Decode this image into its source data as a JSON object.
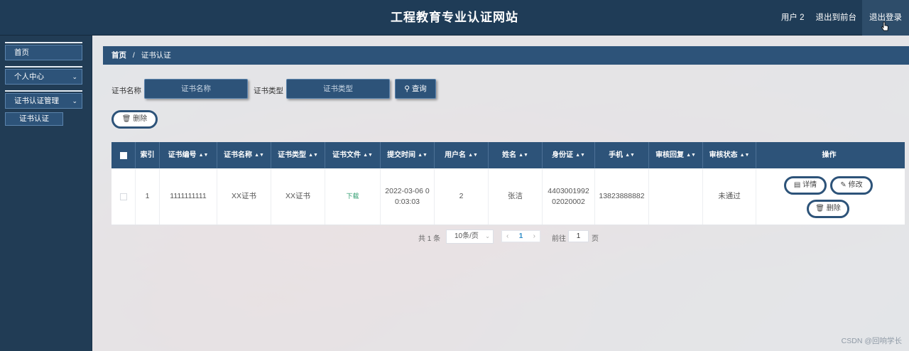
{
  "header": {
    "title": "工程教育专业认证网站",
    "user_label": "用户 2",
    "back_frontend": "退出到前台",
    "logout": "退出登录"
  },
  "sidebar": {
    "items": [
      {
        "label": "首页"
      },
      {
        "label": "个人中心"
      },
      {
        "label": "证书认证管理"
      }
    ],
    "sub_items": [
      {
        "label": "证书认证"
      }
    ]
  },
  "breadcrumb": {
    "home": "首页",
    "separator": "/",
    "current": "证书认证"
  },
  "search": {
    "name_label": "证书名称",
    "name_placeholder": "证书名称",
    "type_label": "证书类型",
    "type_placeholder": "证书类型",
    "query_button": "查询"
  },
  "toolbar": {
    "delete_label": "删除"
  },
  "table": {
    "columns": [
      "索引",
      "证书编号",
      "证书名称",
      "证书类型",
      "证书文件",
      "提交时间",
      "用户名",
      "姓名",
      "身份证",
      "手机",
      "审核回复",
      "审核状态",
      "操作"
    ],
    "rows": [
      {
        "index": "1",
        "cert_no": "1111111111",
        "cert_name": "XX证书",
        "cert_type": "XX证书",
        "cert_file": "下载",
        "submit_time": "2022-03-06 00:03:03",
        "username": "2",
        "name": "张洁",
        "id_card": "440300199202020002",
        "phone": "13823888882",
        "reply": "",
        "status": "未通过",
        "actions": {
          "detail": "详情",
          "edit": "修改",
          "delete": "删除"
        }
      }
    ]
  },
  "pagination": {
    "total": "共 1 条",
    "page_size": "10条/页",
    "current_page": "1",
    "goto_label": "前往",
    "goto_value": "1",
    "page_unit": "页"
  },
  "watermark": "CSDN @回响学长",
  "colors": {
    "primary": "#2d5379",
    "header_bg": "#1f3c57",
    "download_link": "#2e9c6e"
  }
}
